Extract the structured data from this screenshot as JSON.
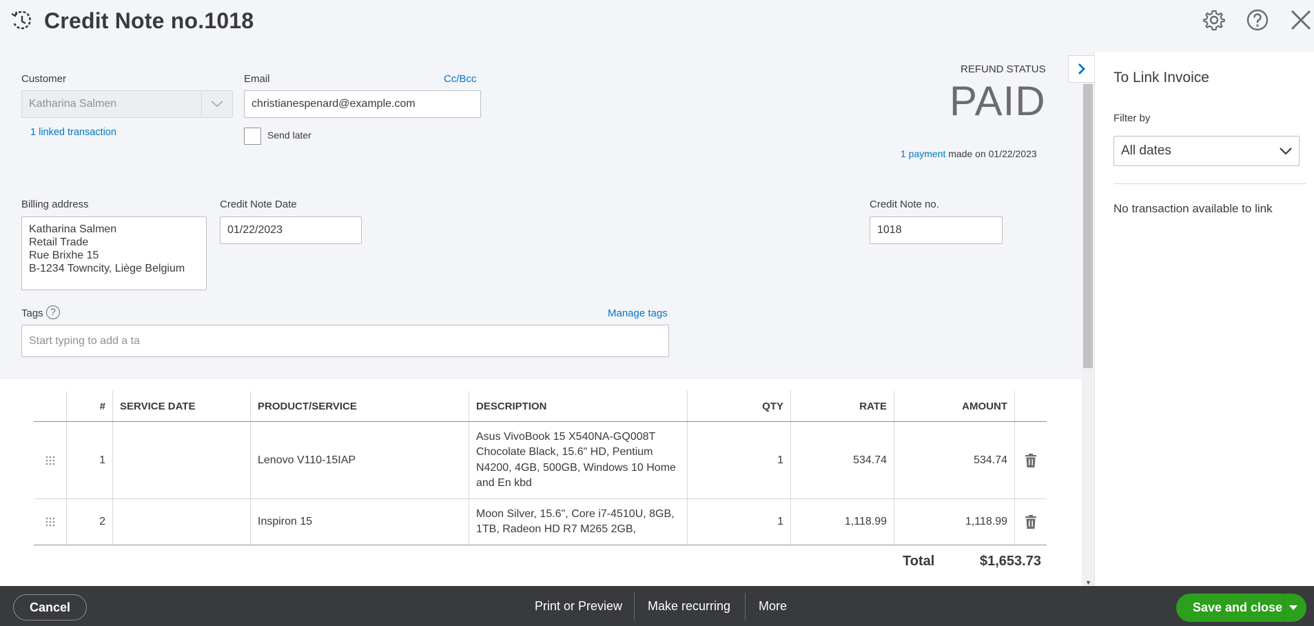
{
  "header": {
    "title": "Credit Note no.1018"
  },
  "form": {
    "customer_label": "Customer",
    "customer_value": "Katharina Salmen",
    "linked_transaction": "1 linked transaction",
    "email_label": "Email",
    "cc_bcc": "Cc/Bcc",
    "email_value": "christianespenard@example.com",
    "send_later": "Send later",
    "refund_status_label": "REFUND STATUS",
    "refund_status_value": "PAID",
    "payment_link": "1 payment",
    "payment_made_on": "made on 01/22/2023",
    "billing_label": "Billing address",
    "billing_value": "Katharina Salmen\nRetail Trade\nRue Brixhe 15\nB-1234 Towncity, Liège Belgium",
    "date_label": "Credit Note Date",
    "date_value": "01/22/2023",
    "no_label": "Credit Note no.",
    "no_value": "1018",
    "tags_label": "Tags",
    "tags_help": "?",
    "manage_tags": "Manage tags",
    "tags_placeholder": "Start typing to add a ta"
  },
  "table": {
    "headers": [
      "#",
      "SERVICE DATE",
      "PRODUCT/SERVICE",
      "DESCRIPTION",
      "QTY",
      "RATE",
      "AMOUNT"
    ],
    "rows": [
      {
        "num": "1",
        "service_date": "",
        "product": "Lenovo V110-15IAP",
        "description": "Asus VivoBook 15 X540NA-GQ008T Chocolate Black, 15.6\" HD, Pentium N4200, 4GB, 500GB, Windows 10 Home and En kbd",
        "qty": "1",
        "rate": "534.74",
        "amount": "534.74"
      },
      {
        "num": "2",
        "service_date": "",
        "product": "Inspiron 15",
        "description": "Moon Silver, 15.6\", Core i7-4510U, 8GB, 1TB, Radeon HD R7 M265 2GB,",
        "qty": "1",
        "rate": "1,118.99",
        "amount": "1,118.99"
      }
    ],
    "total_label": "Total",
    "total_value": "$1,653.73"
  },
  "panel": {
    "title": "To Link Invoice",
    "filter_label": "Filter by",
    "filter_value": "All dates",
    "empty_text": "No transaction available to link"
  },
  "footer": {
    "cancel": "Cancel",
    "print": "Print or Preview",
    "recurring": "Make recurring",
    "more": "More",
    "save": "Save and close"
  },
  "colors": {
    "link": "#0077c5",
    "save_green": "#2ca01c",
    "footer_bg": "#393a3d"
  }
}
